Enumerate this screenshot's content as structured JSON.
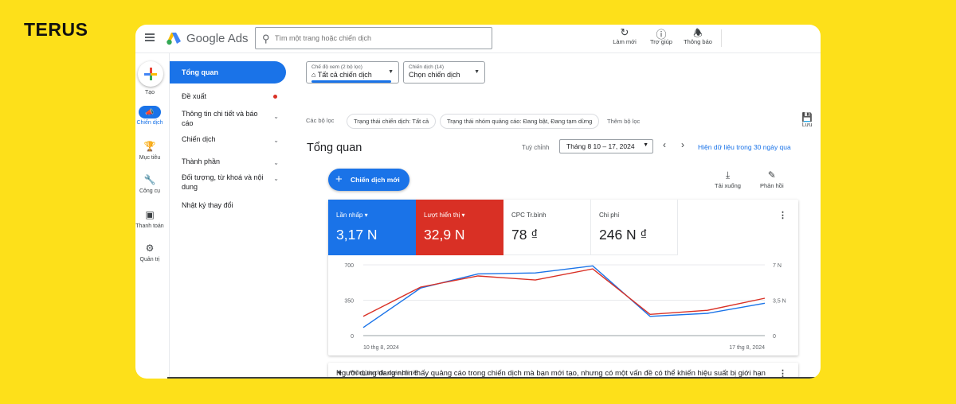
{
  "brand": "TERUS",
  "app": {
    "name": "Google Ads"
  },
  "search": {
    "placeholder": "Tìm một trang hoặc chiến dịch"
  },
  "top_actions": [
    {
      "icon": "refresh-icon",
      "label": "Làm mới"
    },
    {
      "icon": "help-icon",
      "label": "Trợ giúp"
    },
    {
      "icon": "bell-icon",
      "label": "Thông báo"
    }
  ],
  "rail": {
    "create": "Tạo",
    "campaigns": "Chiến dịch",
    "goals": "Mục tiêu",
    "tools": "Công cụ",
    "billing": "Thanh toán",
    "admin": "Quản trị"
  },
  "nav": {
    "overview": "Tổng quan",
    "recommendations": "Đề xuất",
    "insights": "Thông tin chi tiết và báo cáo",
    "campaigns": "Chiến dịch",
    "assets": "Thành phần",
    "audiences": "Đối tượng, từ khoá và nội dung",
    "change_history": "Nhật ký thay đổi"
  },
  "view_mode": {
    "label": "Chế độ xem (2 bộ lọc)",
    "value": "Tất cả chiến dịch"
  },
  "campaign_select": {
    "label": "Chiến dịch (14)",
    "value": "Chọn chiến dịch"
  },
  "filters": {
    "label": "Các bộ lọc",
    "chip1": "Trạng thái chiến dịch: Tất cả",
    "chip2": "Trạng thái nhóm quảng cáo: Đang bật, Đang tạm dừng",
    "add": "Thêm bộ lọc",
    "save": "Lưu"
  },
  "page_title": "Tổng quan",
  "date": {
    "custom_label": "Tuỳ chỉnh",
    "range": "Tháng 8 10 – 17, 2024",
    "link": "Hiện dữ liệu trong 30 ngày qua"
  },
  "new_campaign": "Chiến dịch mới",
  "tools": {
    "download": "Tải xuống",
    "feedback": "Phản hồi"
  },
  "metrics": [
    {
      "label": "Lần nhấp",
      "value": "3,17 N",
      "color": "#1a73e8"
    },
    {
      "label": "Lượt hiển thị",
      "value": "32,9 N",
      "color": "#d93025"
    },
    {
      "label": "CPC Tr.bình",
      "value": "78 ₫"
    },
    {
      "label": "Chi phí",
      "value": "246 N ₫"
    }
  ],
  "chart_data": {
    "type": "line",
    "x": [
      "10 thg 8, 2024",
      "11 thg 8, 2024",
      "12 thg 8, 2024",
      "13 thg 8, 2024",
      "14 thg 8, 2024",
      "15 thg 8, 2024",
      "16 thg 8, 2024",
      "17 thg 8, 2024"
    ],
    "x_tick_labels": [
      "10 thg 8, 2024",
      "17 thg 8, 2024"
    ],
    "y_left_ticks": [
      "0",
      "350",
      "700"
    ],
    "y_left_lim": [
      0,
      700
    ],
    "y_right_ticks": [
      "0",
      "3,5 N",
      "7 N"
    ],
    "y_right_lim": [
      0,
      7000
    ],
    "grid": true,
    "series": [
      {
        "name": "Lần nhấp",
        "axis": "left",
        "color": "#1a73e8",
        "values": [
          80,
          470,
          610,
          620,
          690,
          190,
          220,
          320
        ]
      },
      {
        "name": "Lượt hiển thị",
        "axis": "right",
        "color": "#d93025",
        "values": [
          1900,
          4800,
          5900,
          5500,
          6600,
          2100,
          2500,
          3700
        ]
      }
    ]
  },
  "diagnostics": {
    "title": "Thông tin chẩn đoán chi tiết",
    "text": "Người dùng đang nhìn thấy quảng cáo trong chiến dịch mà bạn mới tạo, nhưng có một vấn đề có thể khiến hiệu suất bị giới hạn"
  }
}
